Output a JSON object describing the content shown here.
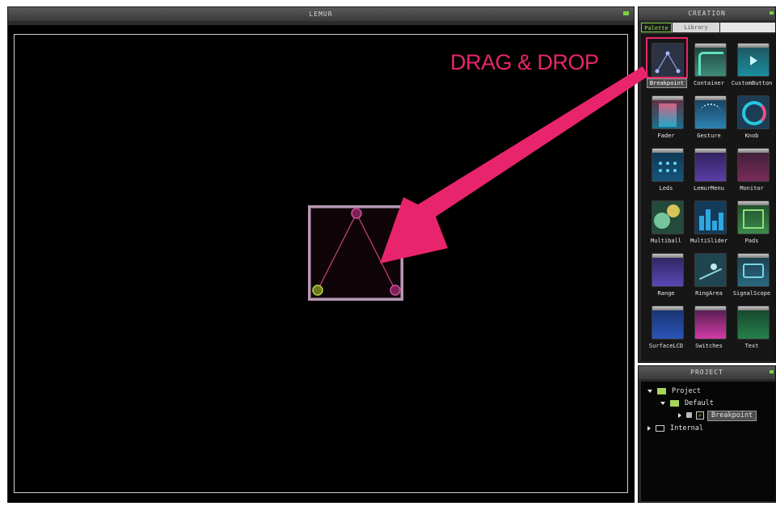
{
  "lemur_panel": {
    "title": "LEMUR"
  },
  "creation_panel": {
    "title": "CREATION",
    "tabs": [
      {
        "label": "Palette"
      },
      {
        "label": "Library"
      }
    ],
    "items": [
      {
        "label": "Breakpoint",
        "icon": "breakpoint-icon"
      },
      {
        "label": "Container",
        "icon": "container-icon"
      },
      {
        "label": "CustomButton",
        "icon": "custom-button-icon"
      },
      {
        "label": "Fader",
        "icon": "fader-icon"
      },
      {
        "label": "Gesture",
        "icon": "gesture-icon"
      },
      {
        "label": "Knob",
        "icon": "knob-icon"
      },
      {
        "label": "Leds",
        "icon": "leds-icon"
      },
      {
        "label": "LemurMenu",
        "icon": "lemur-menu-icon"
      },
      {
        "label": "Monitor",
        "icon": "monitor-icon"
      },
      {
        "label": "Multiball",
        "icon": "multiball-icon"
      },
      {
        "label": "MultiSlider",
        "icon": "multislider-icon"
      },
      {
        "label": "Pads",
        "icon": "pads-icon"
      },
      {
        "label": "Range",
        "icon": "range-icon"
      },
      {
        "label": "RingArea",
        "icon": "ringarea-icon"
      },
      {
        "label": "SignalScope",
        "icon": "signalscope-icon"
      },
      {
        "label": "SurfaceLCD",
        "icon": "surfacelcd-icon"
      },
      {
        "label": "Switches",
        "icon": "switches-icon"
      },
      {
        "label": "Text",
        "icon": "text-icon"
      }
    ]
  },
  "project_panel": {
    "title": "PROJECT",
    "tree": {
      "project": "Project",
      "default": "Default",
      "breakpoint": "Breakpoint",
      "internal": "Internal"
    }
  },
  "annotation": {
    "text": "DRAG & DROP",
    "color": "#e8256c"
  },
  "colors": {
    "accent_green": "#7cd043",
    "annotation_pink": "#e8256c"
  }
}
